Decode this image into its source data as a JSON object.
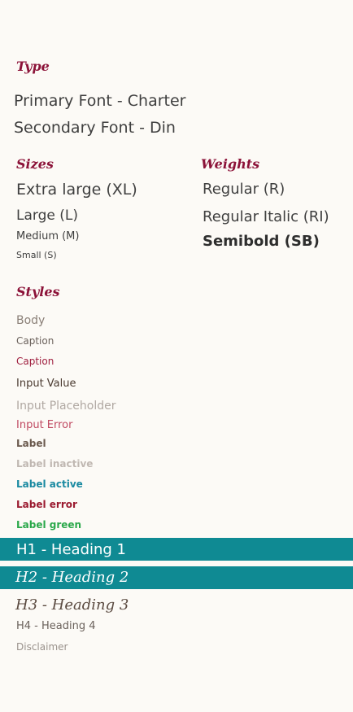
{
  "sections": {
    "type_title": "Type",
    "sizes_title": "Sizes",
    "weights_title": "Weights",
    "styles_title": "Styles"
  },
  "fonts": {
    "primary": "Primary Font - Charter",
    "secondary": "Secondary Font - Din"
  },
  "sizes": [
    "Extra large (XL)",
    "Large (L)",
    "Medium (M)",
    "Small (S)"
  ],
  "weights": [
    "Regular (R)",
    "Regular Italic (RI)",
    "Semibold (SB)"
  ],
  "styles": {
    "body": "Body",
    "caption_1": "Caption",
    "caption_2": "Caption",
    "input_value": "Input Value",
    "input_placeholder": "Input Placeholder",
    "input_error": "Input Error",
    "label": "Label",
    "label_inactive": "Label inactive",
    "label_active": "Label active",
    "label_error": "Label error",
    "label_green": "Label green",
    "h1": "H1 - Heading 1",
    "h2": "H2 - Heading 2",
    "h3": "H3 - Heading 3",
    "h4": "H4 - Heading 4",
    "disclaimer": "Disclaimer"
  },
  "colors": {
    "background": "#fcfaf6",
    "accent_maroon": "#8c1339",
    "teal_bar": "#0f8a93",
    "label_active": "#1a8aa1",
    "label_error": "#9b1b30",
    "label_green": "#2aa84a",
    "input_error": "#c04a62",
    "caption_maroon": "#a02040"
  }
}
